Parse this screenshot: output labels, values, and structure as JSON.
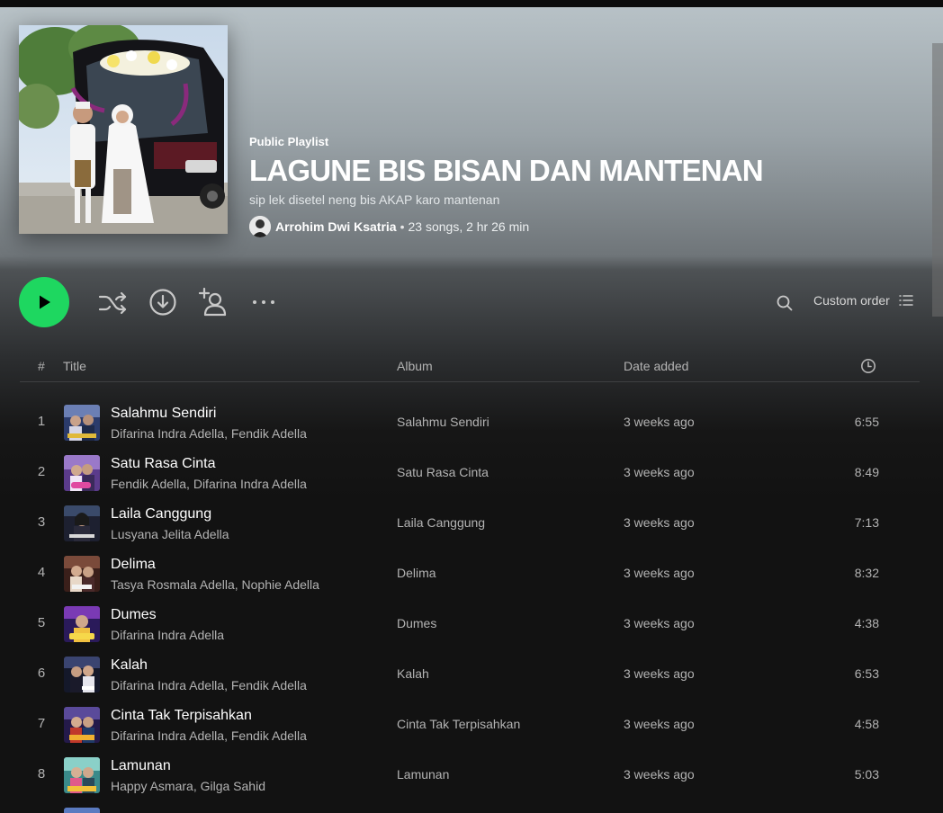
{
  "header": {
    "type_label": "Public Playlist",
    "title": "LAGUNE BIS BISAN DAN MANTENAN",
    "description": "sip lek disetel neng bis AKAP karo mantenan",
    "owner": "Arrohim Dwi Ksatria",
    "separator": "•",
    "stats": "23 songs, 2 hr 26 min"
  },
  "actions": {
    "play_icon": "play-icon",
    "shuffle_icon": "shuffle-icon",
    "download_icon": "download-icon",
    "add_user_icon": "add-user-icon",
    "more_icon": "more-icon",
    "search_icon": "search-icon",
    "sort_label": "Custom order",
    "sort_icon": "list-icon"
  },
  "table": {
    "headers": {
      "num": "#",
      "title": "Title",
      "album": "Album",
      "date": "Date added",
      "duration_icon": "clock-icon"
    },
    "rows": [
      {
        "num": "1",
        "title": "Salahmu Sendiri",
        "artists": "Difarina Indra Adella, Fendik Adella",
        "album": "Salahmu Sendiri",
        "date": "3 weeks ago",
        "duration": "6:55"
      },
      {
        "num": "2",
        "title": "Satu Rasa Cinta",
        "artists": "Fendik Adella, Difarina Indra Adella",
        "album": "Satu Rasa Cinta",
        "date": "3 weeks ago",
        "duration": "8:49"
      },
      {
        "num": "3",
        "title": "Laila Canggung",
        "artists": "Lusyana Jelita Adella",
        "album": "Laila Canggung",
        "date": "3 weeks ago",
        "duration": "7:13"
      },
      {
        "num": "4",
        "title": "Delima",
        "artists": "Tasya Rosmala Adella, Nophie Adella",
        "album": "Delima",
        "date": "3 weeks ago",
        "duration": "8:32"
      },
      {
        "num": "5",
        "title": "Dumes",
        "artists": "Difarina Indra Adella",
        "album": "Dumes",
        "date": "3 weeks ago",
        "duration": "4:38"
      },
      {
        "num": "6",
        "title": "Kalah",
        "artists": "Difarina Indra Adella, Fendik Adella",
        "album": "Kalah",
        "date": "3 weeks ago",
        "duration": "6:53"
      },
      {
        "num": "7",
        "title": "Cinta Tak Terpisahkan",
        "artists": "Difarina Indra Adella, Fendik Adella",
        "album": "Cinta Tak Terpisahkan",
        "date": "3 weeks ago",
        "duration": "4:58"
      },
      {
        "num": "8",
        "title": "Lamunan",
        "artists": "Happy Asmara, Gilga Sahid",
        "album": "Lamunan",
        "date": "3 weeks ago",
        "duration": "5:03"
      }
    ]
  },
  "colors": {
    "accent": "#1ed760",
    "background": "#121212",
    "muted_text": "#b3b3b3"
  }
}
